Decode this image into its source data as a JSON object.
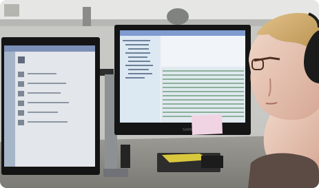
{
  "photo": {
    "left_monitor_brand": "",
    "center_monitor_brand": "SAMSUNG"
  }
}
